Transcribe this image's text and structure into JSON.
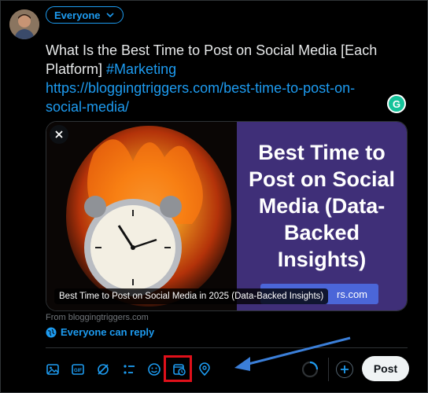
{
  "audience": {
    "label": "Everyone"
  },
  "post": {
    "text_main": "What Is the Best Time to Post on Social Media [Each Platform]",
    "hashtag": "#Marketing",
    "link_line1": "https://bloggingtriggers.com/best-time-to-post-on-",
    "link_line2": "social-media/"
  },
  "grammarly": {
    "letter": "G"
  },
  "card": {
    "headline_lines": [
      "Best Time to",
      "Post on Social",
      "Media (Data-",
      "Backed",
      "Insights)"
    ],
    "pill_text": "rs.com",
    "caption": "Best Time to Post on Social Media in 2025 (Data-Backed Insights)",
    "from": "From bloggingtriggers.com"
  },
  "reply": {
    "label": "Everyone can reply"
  },
  "toolbar": {
    "icons": [
      "media-icon",
      "gif-icon",
      "grok-icon",
      "poll-icon",
      "emoji-icon",
      "schedule-icon",
      "location-icon"
    ]
  },
  "post_button": {
    "label": "Post"
  },
  "colors": {
    "accent": "#1d9bf0",
    "highlight": "#e0101a",
    "card_bg": "#3f2f78"
  }
}
